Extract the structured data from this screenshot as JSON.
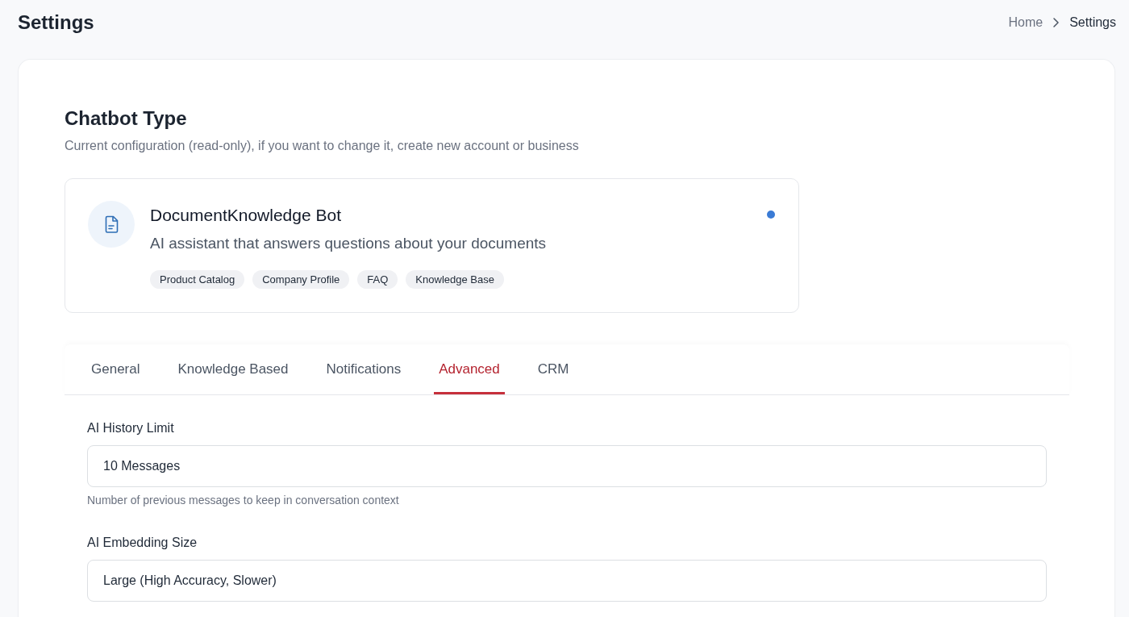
{
  "page": {
    "title": "Settings"
  },
  "breadcrumb": [
    {
      "label": "Home",
      "current": false
    },
    {
      "label": "Settings",
      "current": true
    }
  ],
  "chatbot_type": {
    "title": "Chatbot Type",
    "subtitle": "Current configuration (read-only), if you want to change it, create new account or business",
    "bot": {
      "name": "DocumentKnowledge Bot",
      "description": "AI assistant that answers questions about your documents",
      "active": true,
      "tags": [
        "Product Catalog",
        "Company Profile",
        "FAQ",
        "Knowledge Base"
      ]
    }
  },
  "tabs": [
    {
      "label": "General",
      "selected": false
    },
    {
      "label": "Knowledge Based",
      "selected": false
    },
    {
      "label": "Notifications",
      "selected": false
    },
    {
      "label": "Advanced",
      "selected": true
    },
    {
      "label": "CRM",
      "selected": false
    }
  ],
  "fields": [
    {
      "label": "AI History Limit",
      "value": "10 Messages",
      "help": "Number of previous messages to keep in conversation context"
    },
    {
      "label": "AI Embedding Size",
      "value": "Large (High Accuracy, Slower)"
    }
  ]
}
